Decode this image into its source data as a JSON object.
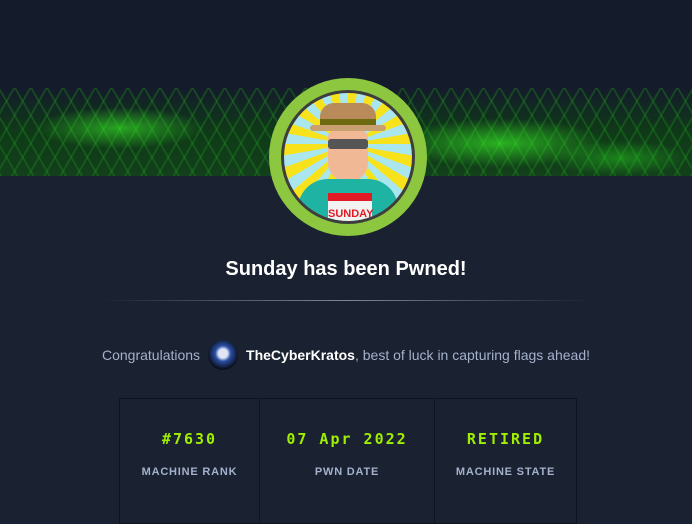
{
  "machine": {
    "name": "Sunday",
    "badge_text": "SUNDAY"
  },
  "title": "Sunday has been Pwned!",
  "congrats": {
    "prefix": "Congratulations",
    "username": "TheCyberKratos",
    "suffix": ", best of luck in capturing flags ahead!"
  },
  "stats": [
    {
      "value": "#7630",
      "label": "MACHINE RANK"
    },
    {
      "value": "07 Apr 2022",
      "label": "PWN DATE"
    },
    {
      "value": "RETIRED",
      "label": "MACHINE STATE"
    }
  ],
  "colors": {
    "accent": "#9fef00",
    "avatar_ring": "#8dc63f",
    "background": "#1a2130"
  }
}
